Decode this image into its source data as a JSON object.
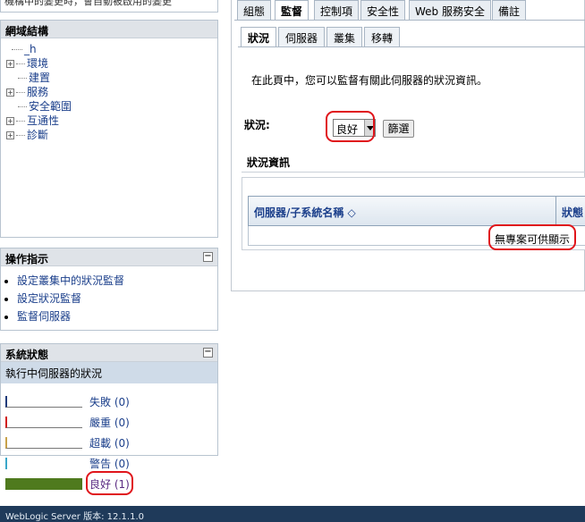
{
  "top_clip_text": "機構中的變更時，會自動被啟用的變更",
  "domain_structure": {
    "title": "網域結構",
    "root": "_h",
    "items": [
      {
        "label": "環境",
        "expandable": true
      },
      {
        "label": "建置",
        "expandable": false
      },
      {
        "label": "服務",
        "expandable": true
      },
      {
        "label": "安全範圍",
        "expandable": false
      },
      {
        "label": "互通性",
        "expandable": true
      },
      {
        "label": "診斷",
        "expandable": true
      }
    ]
  },
  "how_do_i": {
    "title": "操作指示",
    "links": [
      "設定叢集中的狀況監督",
      "設定狀況監督",
      "監督伺服器"
    ]
  },
  "system_status": {
    "title": "系統狀態",
    "subtitle": "執行中伺服器的狀況",
    "rows": [
      {
        "label": "失敗 (0)",
        "color": "#1f3a7a",
        "fill": 0
      },
      {
        "label": "嚴重 (0)",
        "color": "#d11b1b",
        "fill": 0
      },
      {
        "label": "超載 (0)",
        "color": "#c8a24a",
        "fill": 0
      },
      {
        "label": "警告 (0)",
        "color": "#3aa7c9",
        "fill": 0
      },
      {
        "label": "良好 (1)",
        "color": "#4f7a1e",
        "fill": 1
      }
    ]
  },
  "footer": "WebLogic Server 版本: 12.1.1.0",
  "tabs": [
    "組態",
    "監督",
    "控制項",
    "安全性",
    "Web 服務安全",
    "備註"
  ],
  "active_tab": "監督",
  "subtabs": [
    "狀況",
    "伺服器",
    "叢集",
    "移轉"
  ],
  "active_subtab": "狀況",
  "intro_text": "在此頁中，您可以監督有關此伺服器的狀況資訊。",
  "filter": {
    "label": "狀況:",
    "selected": "良好",
    "button": "篩選"
  },
  "status_info": {
    "title": "狀況資訊",
    "columns": [
      "伺服器/子系統名稱 ◇",
      "狀態"
    ],
    "empty_message": "無專案可供顯示"
  }
}
